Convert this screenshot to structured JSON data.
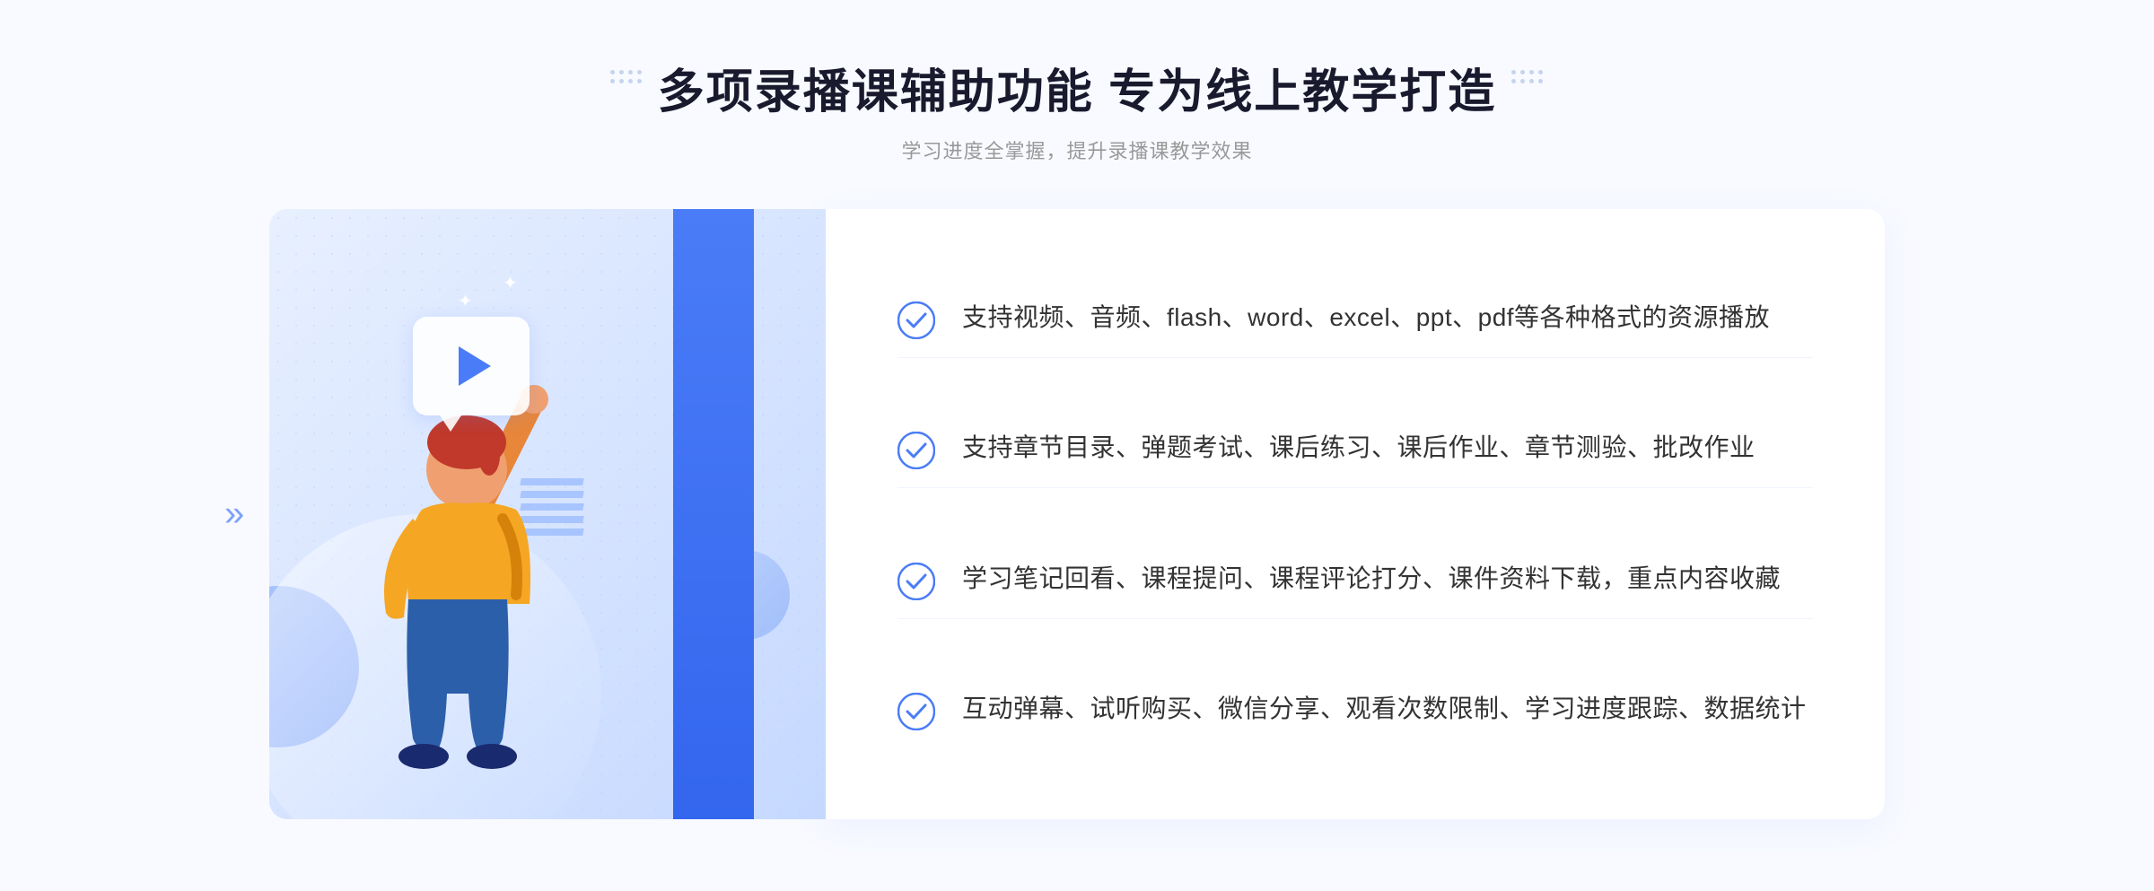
{
  "header": {
    "main_title": "多项录播课辅助功能 专为线上教学打造",
    "sub_title": "学习进度全掌握，提升录播课教学效果"
  },
  "features": [
    {
      "id": "feature-1",
      "text": "支持视频、音频、flash、word、excel、ppt、pdf等各种格式的资源播放"
    },
    {
      "id": "feature-2",
      "text": "支持章节目录、弹题考试、课后练习、课后作业、章节测验、批改作业"
    },
    {
      "id": "feature-3",
      "text": "学习笔记回看、课程提问、课程评论打分、课件资料下载，重点内容收藏"
    },
    {
      "id": "feature-4",
      "text": "互动弹幕、试听购买、微信分享、观看次数限制、学习进度跟踪、数据统计"
    }
  ],
  "colors": {
    "primary_blue": "#4a7cf7",
    "light_blue_bg": "#e8f0ff",
    "check_icon_color": "#4a7cf7",
    "title_color": "#1a1a2e",
    "subtitle_color": "#999999",
    "text_color": "#333333"
  },
  "decorative": {
    "left_arrow": "»",
    "sparkle": "✦"
  }
}
